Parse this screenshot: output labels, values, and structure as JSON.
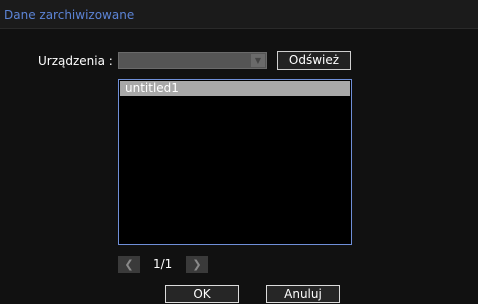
{
  "window": {
    "title": "Dane zarchiwizowane"
  },
  "device": {
    "label": "Urządzenia :",
    "selected": "",
    "refresh_label": "Odśwież"
  },
  "list": {
    "items": [
      "untitled1"
    ]
  },
  "pager": {
    "prev_icon": "chevron-left-icon",
    "next_icon": "chevron-right-icon",
    "text": "1/1"
  },
  "buttons": {
    "ok": "OK",
    "cancel": "Anuluj"
  },
  "colors": {
    "title": "#5c84d6",
    "list_border": "#6f8fd8",
    "selected_row": "#a8a8a8"
  }
}
